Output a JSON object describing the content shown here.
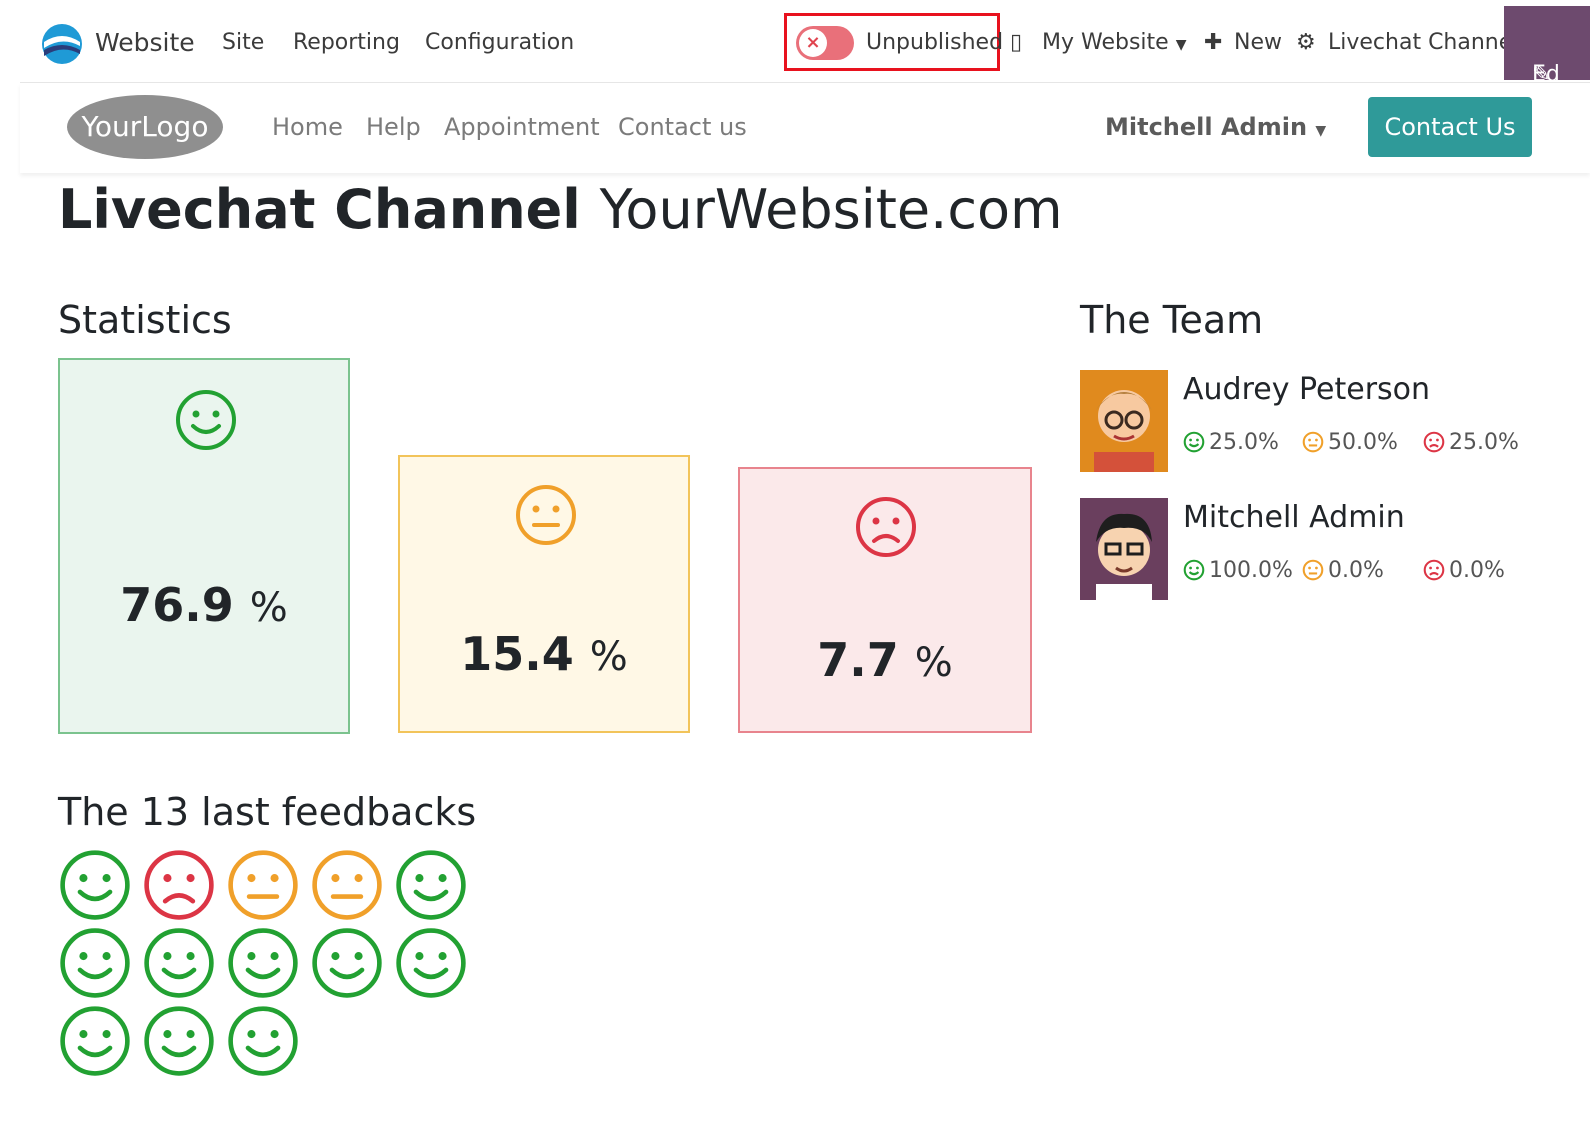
{
  "topbar": {
    "app_name": "Website",
    "menu": [
      "Site",
      "Reporting",
      "Configuration"
    ],
    "publish_status": "Unpublished",
    "website_selector": "My Website",
    "new_label": "New",
    "record_label": "Livechat Channel",
    "edit_label": "Ed"
  },
  "site_nav": {
    "logo_text": "YourLogo",
    "links": [
      "Home",
      "Help",
      "Appointment",
      "Contact us"
    ],
    "user": "Mitchell Admin",
    "cta": "Contact Us"
  },
  "page": {
    "title_main": "Livechat Channel",
    "title_sub": "YourWebsite.com",
    "statistics_heading": "Statistics",
    "team_heading": "The Team",
    "feedback_heading": "The 13 last feedbacks"
  },
  "statistics": [
    {
      "mood": "happy",
      "value": "76.9",
      "unit": "%",
      "color": "#28a745"
    },
    {
      "mood": "neutral",
      "value": "15.4",
      "unit": "%",
      "color": "#f0a02a"
    },
    {
      "mood": "sad",
      "value": "7.7",
      "unit": "%",
      "color": "#dc3545"
    }
  ],
  "team": [
    {
      "name": "Audrey Peterson",
      "happy": "25.0%",
      "neutral": "50.0%",
      "sad": "25.0%"
    },
    {
      "name": "Mitchell Admin",
      "happy": "100.0%",
      "neutral": "0.0%",
      "sad": "0.0%"
    }
  ],
  "feedbacks": [
    "happy",
    "sad",
    "neutral",
    "neutral",
    "happy",
    "happy",
    "happy",
    "happy",
    "happy",
    "happy",
    "happy",
    "happy",
    "happy"
  ],
  "colors": {
    "happy": "#22a132",
    "neutral": "#f0a02a",
    "sad": "#dc3545",
    "edit_bg": "#6d4a6e",
    "cta_bg": "#2f9a99",
    "highlight": "#e8121e"
  }
}
